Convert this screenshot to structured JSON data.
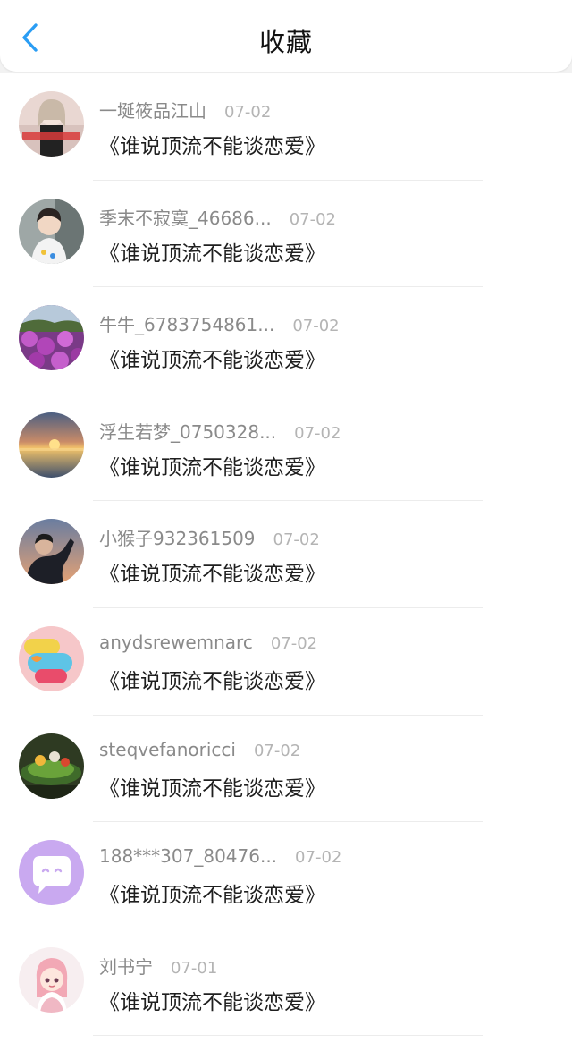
{
  "header": {
    "title": "收藏",
    "back_icon": "chevron-left-icon",
    "accent_color": "#2a9df4"
  },
  "items": [
    {
      "username": "一埏筱品江山",
      "date": "07-02",
      "book": "《谁说顶流不能谈恋爱》",
      "avatar": "portrait-girl"
    },
    {
      "username": "季末不寂寞_46686...",
      "date": "07-02",
      "book": "《谁说顶流不能谈恋爱》",
      "avatar": "child-photo"
    },
    {
      "username": "牛牛_6783754861...",
      "date": "07-02",
      "book": "《谁说顶流不能谈恋爱》",
      "avatar": "purple-flowers"
    },
    {
      "username": "浮生若梦_0750328...",
      "date": "07-02",
      "book": "《谁说顶流不能谈恋爱》",
      "avatar": "sunset-sea"
    },
    {
      "username": "小猴子932361509",
      "date": "07-02",
      "book": "《谁说顶流不能谈恋爱》",
      "avatar": "man-portrait"
    },
    {
      "username": "anydsrewemnarc",
      "date": "07-02",
      "book": "《谁说顶流不能谈恋爱》",
      "avatar": "colorful-candy"
    },
    {
      "username": "steqvefanoricci",
      "date": "07-02",
      "book": "《谁说顶流不能谈恋爱》",
      "avatar": "food-plate"
    },
    {
      "username": "188***307_80476...",
      "date": "07-02",
      "book": "《谁说顶流不能谈恋爱》",
      "avatar": "chat-bubble-icon"
    },
    {
      "username": "刘书宁",
      "date": "07-01",
      "book": "《谁说顶流不能谈恋爱》",
      "avatar": "cartoon-girl"
    }
  ]
}
